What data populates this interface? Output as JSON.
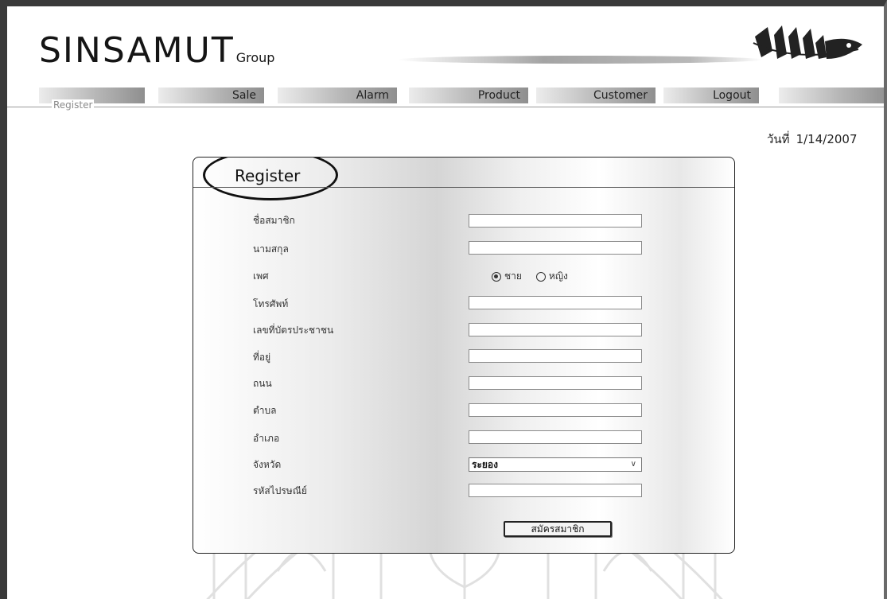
{
  "header": {
    "brand": "SINSAMUT",
    "brand_sub": "Group"
  },
  "nav": {
    "items": [
      {
        "label": ""
      },
      {
        "label": "Sale"
      },
      {
        "label": "Alarm"
      },
      {
        "label": "Product"
      },
      {
        "label": "Customer"
      },
      {
        "label": "Logout"
      },
      {
        "label": ""
      }
    ]
  },
  "breadcrumb": "Register",
  "date": {
    "label": "วันที่",
    "value": "1/14/2007"
  },
  "form": {
    "title": "Register",
    "fields": [
      {
        "label": "ชื่อสมาชิก",
        "value": ""
      },
      {
        "label": "นามสกุล",
        "value": ""
      },
      {
        "label": "เพศ"
      },
      {
        "label": "โทรศัพท์",
        "value": ""
      },
      {
        "label": "เลขที่บัตรประชาชน",
        "value": ""
      },
      {
        "label": "ที่อยู่",
        "value": ""
      },
      {
        "label": "ถนน",
        "value": ""
      },
      {
        "label": "ตำบล",
        "value": ""
      },
      {
        "label": "อำเภอ",
        "value": ""
      },
      {
        "label": "จังหวัด"
      },
      {
        "label": "รหัสไปรษณีย์",
        "value": ""
      }
    ],
    "gender_options": [
      {
        "label": "ชาย",
        "selected": true
      },
      {
        "label": "หญิง",
        "selected": false
      }
    ],
    "province_value": "ระยอง",
    "submit_label": "สมัครสมาชิก"
  },
  "colors": {
    "frame": "#3a3a3a",
    "nav_gradient_dark": "#8f8f8f",
    "nav_gradient_light": "#ececec"
  }
}
